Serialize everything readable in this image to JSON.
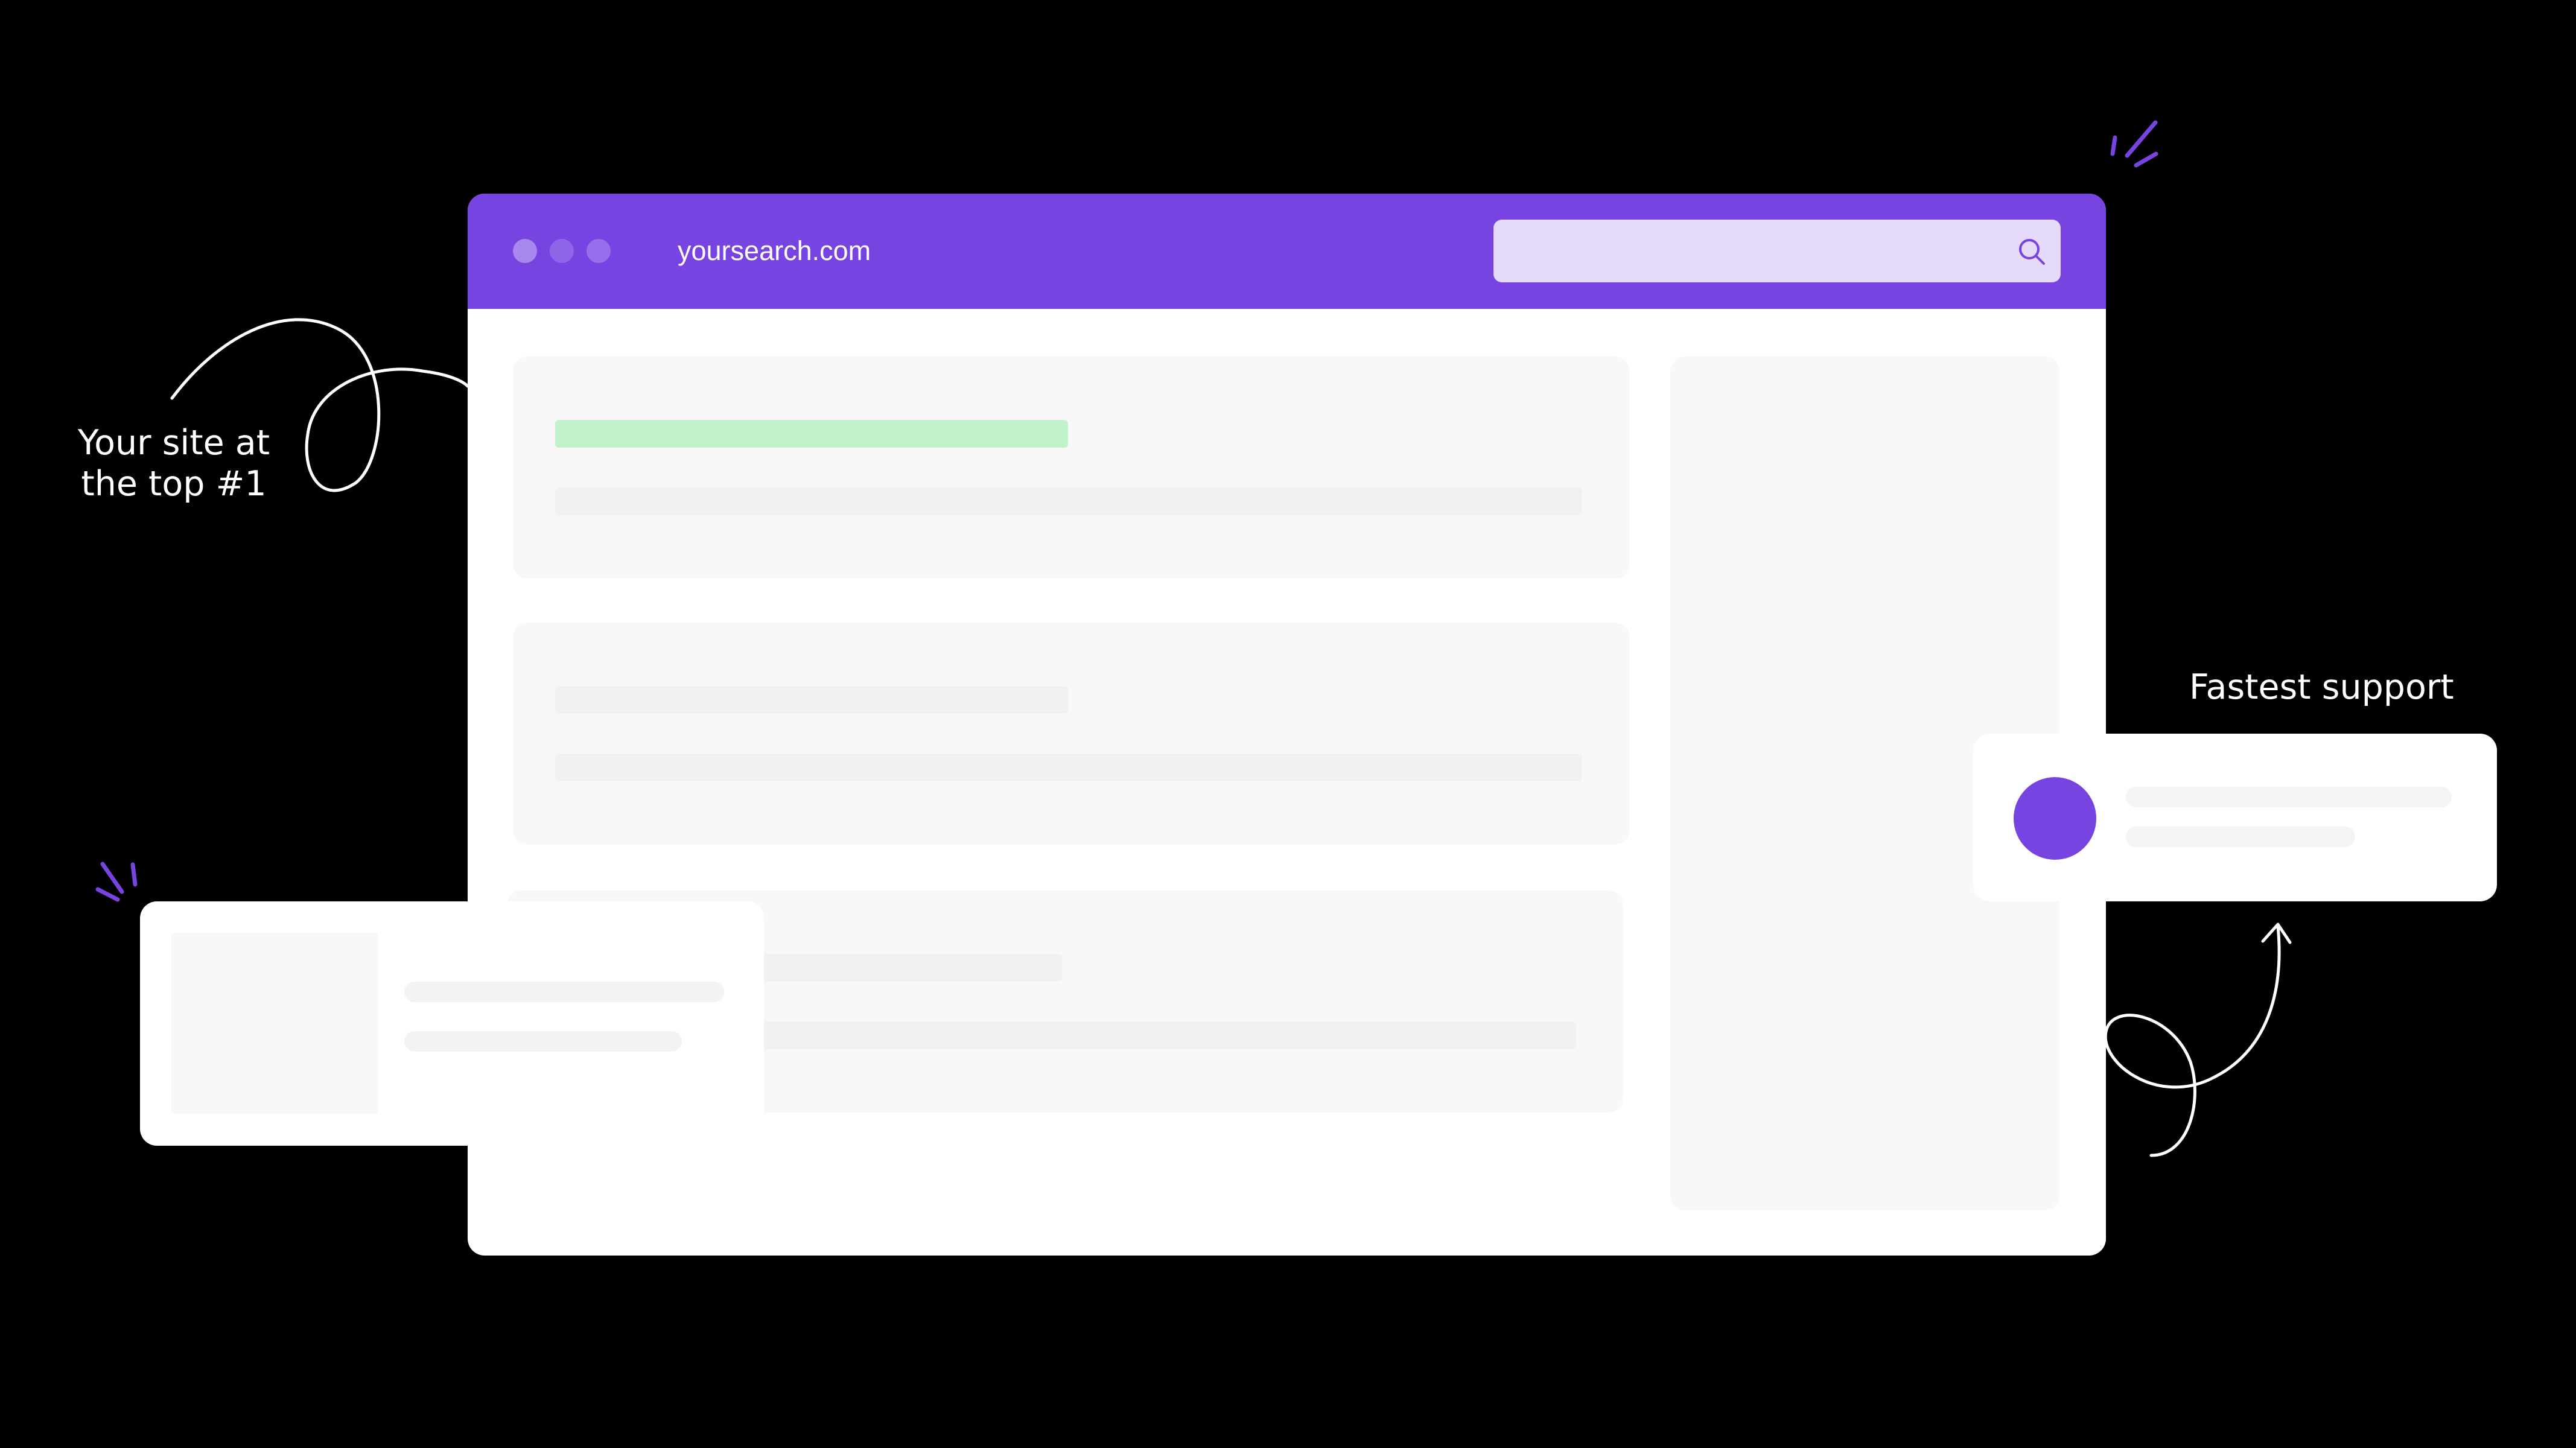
{
  "browser": {
    "url": "yoursearch.com",
    "window_controls": [
      "close-dot",
      "minimize-dot",
      "maximize-dot"
    ],
    "search": {
      "icon": "search-icon",
      "value": ""
    }
  },
  "annotations": {
    "left_note": [
      "Your site at",
      "the top #1"
    ],
    "right_note": "Fastest support"
  },
  "colors": {
    "background": "#000000",
    "accent": "#7744e2",
    "search_field": "#e6dafa",
    "highlight_result": "#c2f2cb",
    "placeholder": "#f8f8f8"
  },
  "results": [
    {
      "highlighted": true
    },
    {
      "highlighted": false
    },
    {
      "highlighted": false
    }
  ]
}
